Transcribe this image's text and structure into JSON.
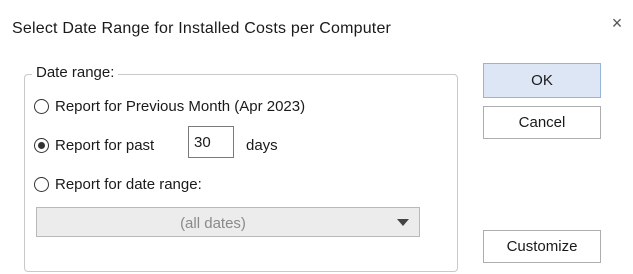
{
  "window": {
    "title": "Select Date Range for Installed Costs per Computer",
    "close_glyph": "×"
  },
  "date_range": {
    "legend": "Date range:",
    "option_previous_month": "Report for Previous Month (Apr 2023)",
    "option_past_days": "Report for past",
    "past_days_value": "30",
    "past_days_unit": "days",
    "option_date_range": "Report for date range:",
    "selected_option": "past_days",
    "date_range_select_value": "(all dates)"
  },
  "buttons": {
    "ok": "OK",
    "cancel": "Cancel",
    "customize": "Customize"
  },
  "icons": {
    "close": "close-icon",
    "dropdown": "chevron-down-icon"
  },
  "colors": {
    "ok_button_bg": "#dce6f4",
    "ok_button_border": "#98b3d6",
    "disabled_combo_bg": "#ececec"
  }
}
